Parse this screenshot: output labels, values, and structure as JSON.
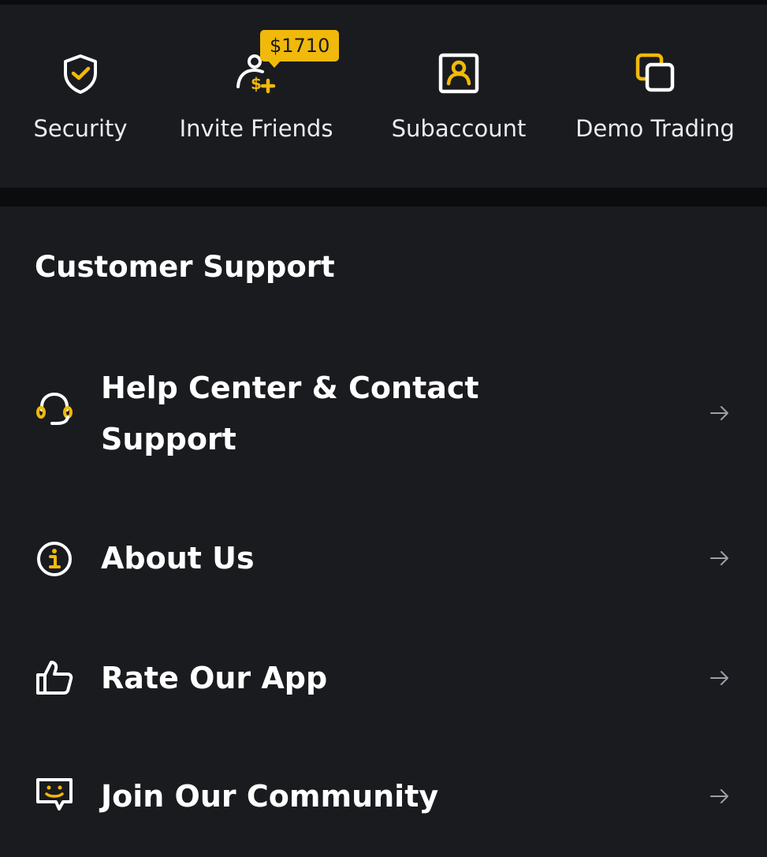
{
  "quick_actions": [
    {
      "id": "security",
      "label": "Security",
      "icon": "shield-check-icon"
    },
    {
      "id": "invite",
      "label": "Invite Friends",
      "icon": "invite-user-dollar-icon",
      "badge": "$1710"
    },
    {
      "id": "subaccount",
      "label": "Subaccount",
      "icon": "user-card-icon"
    },
    {
      "id": "demo",
      "label": "Demo Trading",
      "icon": "stacked-squares-icon"
    }
  ],
  "support": {
    "title": "Customer Support",
    "items": [
      {
        "label": "Help Center & Contact Support",
        "icon": "headset-icon"
      },
      {
        "label": "About Us",
        "icon": "info-circle-icon"
      },
      {
        "label": "Rate Our App",
        "icon": "thumbs-up-icon"
      },
      {
        "label": "Join Our Community",
        "icon": "chat-smile-icon"
      }
    ]
  },
  "colors": {
    "accent": "#f0b90b",
    "panel": "#1a1b1f",
    "background": "#0b0c0e",
    "text": "#eaecef"
  }
}
